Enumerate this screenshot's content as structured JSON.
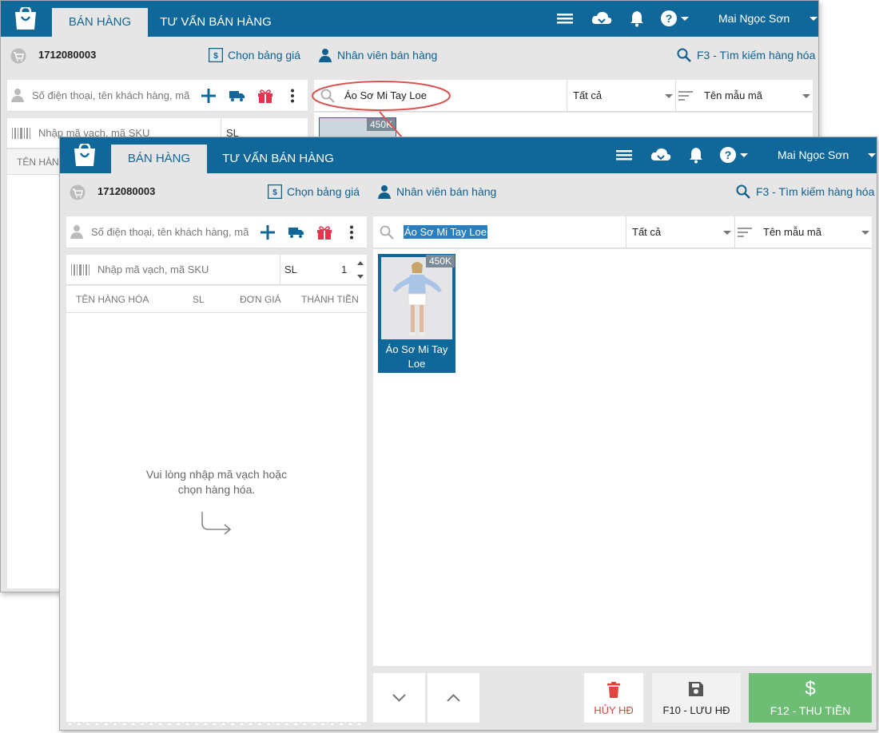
{
  "app": {
    "tabs": [
      "BÁN HÀNG",
      "TƯ VẤN BÁN HÀNG"
    ],
    "user_name": "Mai Ngọc Sơn",
    "order_id": "1712080003",
    "price_list_label": "Chọn bảng giá",
    "staff_label": "Nhân viên bán hàng",
    "search_shortcut": "F3 - Tìm kiếm hàng hóa"
  },
  "customer": {
    "placeholder": "Số điện thoại, tên khách hàng, mã"
  },
  "barcode": {
    "placeholder": "Nhập mã vạch, mã SKU",
    "qty_label": "SL",
    "qty_value": "1"
  },
  "cart_table": {
    "columns": [
      "TÊN HÀNG HÓA",
      "SL",
      "ĐƠN GIÁ",
      "THÀNH TIỀN"
    ]
  },
  "cart_empty": {
    "line1": "Vui lòng nhập mã vạch hoặc",
    "line2": "chọn hàng hóa."
  },
  "product_search": {
    "back_value": "Áo Sơ Mi Tay Loe",
    "front_value": "Áo Sơ Mi Tay Loe",
    "category": "Tất cả",
    "sort": "Tên mẫu mã"
  },
  "products": [
    {
      "name_line1": "Áo Sơ Mi Tay",
      "name_line2": "Loe",
      "price": "450K"
    }
  ],
  "actions": {
    "cancel": "HỦY HĐ",
    "save": "F10 - LƯU HĐ",
    "pay": "F12 - THU TIỀN"
  },
  "back_cart_col": "TÊN HÀN",
  "colors": {
    "brand": "#10689a",
    "pay": "#6dbd75",
    "cancel": "#e0443e",
    "highlight": "#d9534f"
  }
}
